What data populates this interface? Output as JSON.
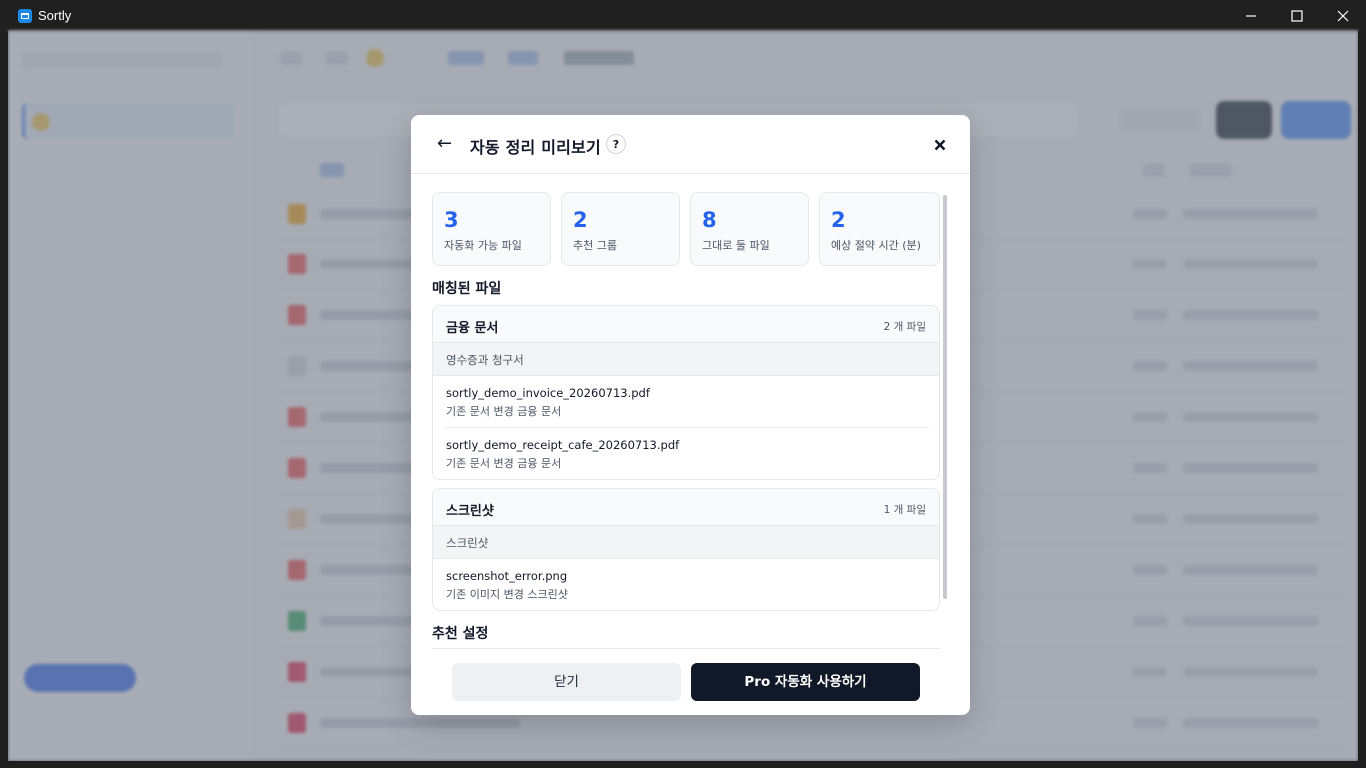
{
  "window": {
    "title": "Sortly",
    "controls": [
      "minimize-icon",
      "maximize-icon",
      "close-icon"
    ]
  },
  "modal": {
    "back_icon": "←",
    "title": "자동 정리 미리보기",
    "help_icon": "?",
    "stats": [
      {
        "value": "3",
        "label": "자동화 가능 파일"
      },
      {
        "value": "2",
        "label": "추천 그룹"
      },
      {
        "value": "8",
        "label": "그대로 둘 파일"
      },
      {
        "value": "2",
        "label": "예상 절약 시간 (분)"
      }
    ],
    "matched_title": "매칭된 파일",
    "groups": [
      {
        "name": "금융 문서",
        "count": "2 개 파일",
        "sub": "영수증과 청구서",
        "files": [
          {
            "name": "sortly_demo_invoice_20260713.pdf",
            "desc": "기존 문서 변경 금융 문서"
          },
          {
            "name": "sortly_demo_receipt_cafe_20260713.pdf",
            "desc": "기존 문서 변경 금융 문서"
          }
        ]
      },
      {
        "name": "스크린샷",
        "count": "1 개 파일",
        "sub": "스크린샷",
        "files": [
          {
            "name": "screenshot_error.png",
            "desc": "기존 이미지 변경 스크린샷"
          }
        ]
      }
    ],
    "settings_title": "추천 설정",
    "footer": {
      "close_label": "닫기",
      "pro_label": "Pro 자동화 사용하기"
    }
  },
  "colors": {
    "accent": "#2563eb",
    "primary_button": "#111827",
    "secondary_button": "#eef0f3"
  }
}
